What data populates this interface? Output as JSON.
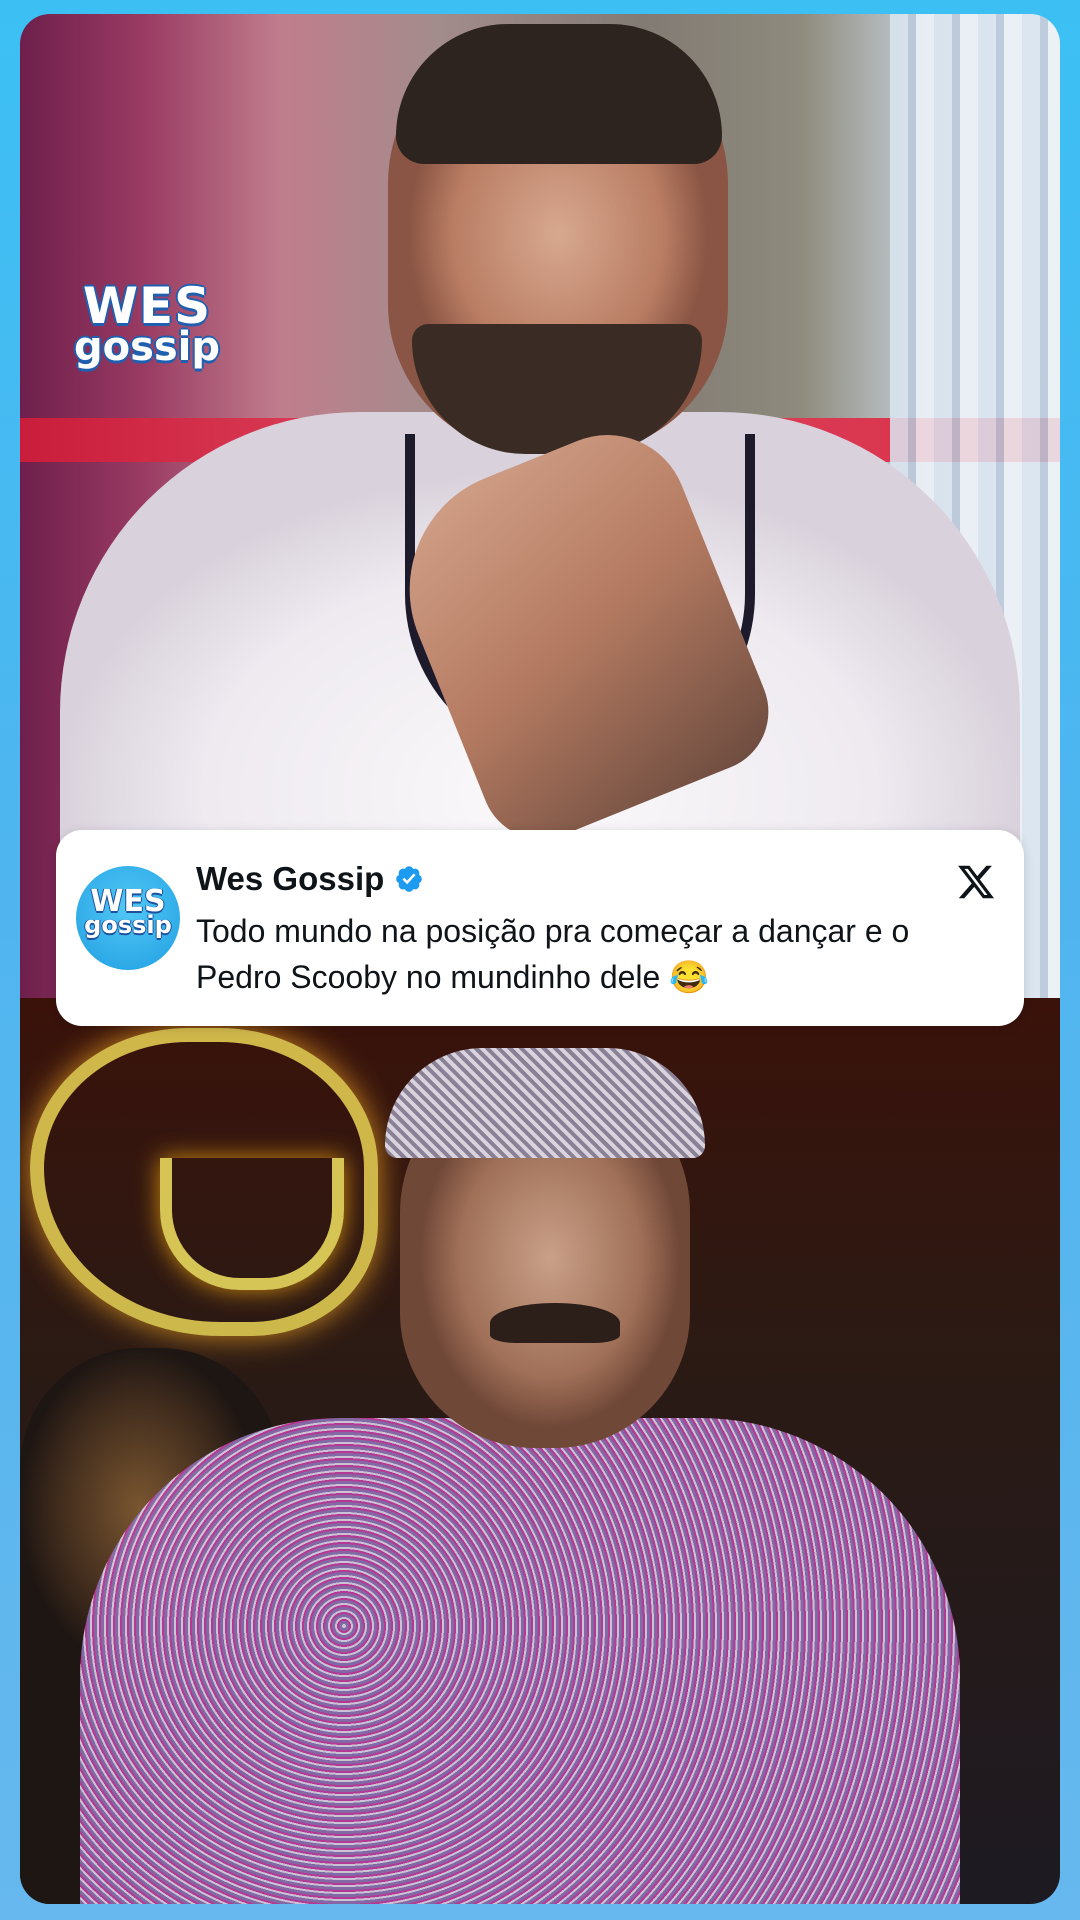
{
  "brand": {
    "logo_line1": "WES",
    "logo_line2": "gossip"
  },
  "tweet": {
    "author_name": "Wes Gossip",
    "verified": true,
    "platform_icon": "x-logo-icon",
    "text": "Todo mundo na posição pra começar a dançar e o Pedro Scooby no mundinho dele 😂"
  },
  "colors": {
    "frame": "#4fb5ef",
    "verified_badge": "#1d9bf0",
    "text": "#0f1419"
  }
}
